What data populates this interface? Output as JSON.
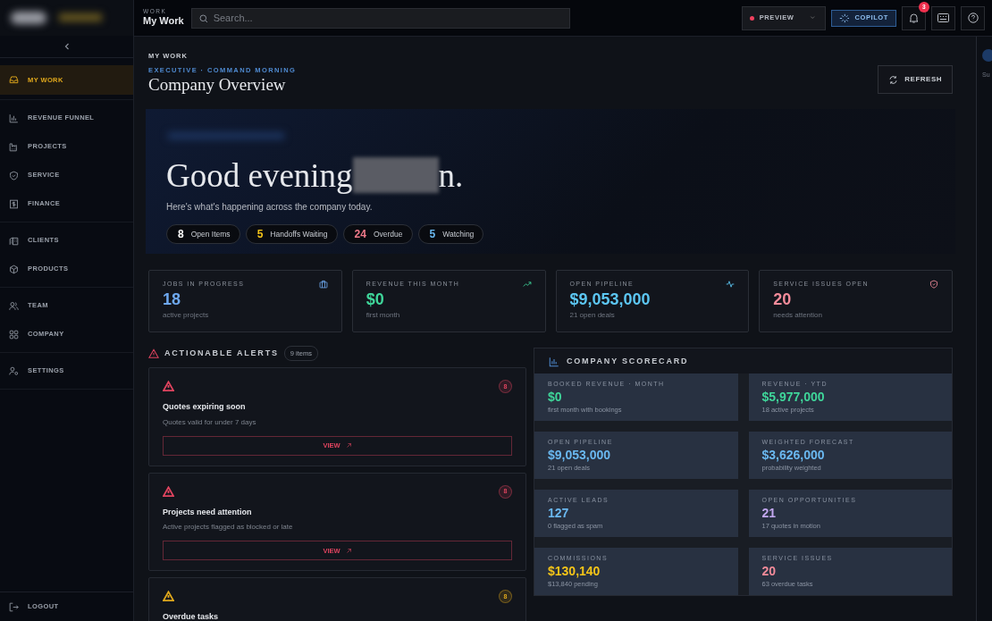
{
  "sidebar": {
    "groups": [
      [
        {
          "label": "MY WORK",
          "selected": true
        }
      ],
      [
        {
          "label": "REVENUE FUNNEL",
          "selected": false
        },
        {
          "label": "PROJECTS",
          "selected": false
        },
        {
          "label": "SERVICE",
          "selected": false
        },
        {
          "label": "FINANCE",
          "selected": false
        }
      ],
      [
        {
          "label": "CLIENTS",
          "selected": false
        },
        {
          "label": "PRODUCTS",
          "selected": false
        }
      ],
      [
        {
          "label": "TEAM",
          "selected": false
        },
        {
          "label": "COMPANY",
          "selected": false
        }
      ],
      [
        {
          "label": "SETTINGS",
          "selected": false
        }
      ]
    ],
    "logout": "LOGOUT"
  },
  "topbar": {
    "eyebrow": "WORK",
    "title": "My Work",
    "search": {
      "placeholder": "Search..."
    },
    "preview": "PREVIEW",
    "copilot": "COPILOT",
    "notifications": "3"
  },
  "side_panel": {
    "tab": "Su"
  },
  "page": {
    "breadcrumb": "MY WORK",
    "eyebrow": "EXECUTIVE · COMMAND MORNING",
    "title": "Company Overview",
    "refresh": "REFRESH"
  },
  "hero": {
    "greeting_start": "Good evening",
    "greeting_end": "n.",
    "subtitle": "Here's what's happening across the company today.",
    "chips": [
      {
        "count": "8",
        "label": "Open Items",
        "color": "#ffffff"
      },
      {
        "count": "5",
        "label": "Handoffs Waiting",
        "color": "#f5c518"
      },
      {
        "count": "24",
        "label": "Overdue",
        "color": "#f27a8a"
      },
      {
        "count": "5",
        "label": "Watching",
        "color": "#6ab8f0"
      }
    ]
  },
  "kpis": [
    {
      "label": "JOBS IN PROGRESS",
      "value": "18",
      "note": "active projects",
      "color": "#6ea8ef"
    },
    {
      "label": "REVENUE THIS MONTH",
      "value": "$0",
      "note": "first month",
      "color": "#3fd69a"
    },
    {
      "label": "OPEN PIPELINE",
      "value": "$9,053,000",
      "note": "21 open deals",
      "color": "#5cc6f2"
    },
    {
      "label": "SERVICE ISSUES OPEN",
      "value": "20",
      "note": "needs attention",
      "color": "#f28b9a"
    }
  ],
  "alerts": {
    "title": "ACTIONABLE ALERTS",
    "count": "9 items",
    "items": [
      {
        "title": "Quotes expiring soon",
        "description": "Quotes valid for under 7 days",
        "count": "8",
        "color": "#e0445f",
        "action": "VIEW"
      },
      {
        "title": "Projects need attention",
        "description": "Active projects flagged as blocked or late",
        "count": "8",
        "color": "#e0445f",
        "action": "VIEW"
      },
      {
        "title": "Overdue tasks",
        "count": "8",
        "color": "#e0a81c"
      }
    ]
  },
  "scorecard": {
    "title": "COMPANY SCORECARD",
    "tiles": [
      {
        "label": "BOOKED REVENUE · MONTH",
        "value": "$0",
        "note": "first month with bookings",
        "color": "#3fd69a"
      },
      {
        "label": "REVENUE · YTD",
        "value": "$5,977,000",
        "note": "18 active projects",
        "color": "#3fd69a"
      },
      {
        "label": "OPEN PIPELINE",
        "value": "$9,053,000",
        "note": "21 open deals",
        "color": "#6ab8f0"
      },
      {
        "label": "WEIGHTED FORECAST",
        "value": "$3,626,000",
        "note": "probability weighted",
        "color": "#6ab8f0"
      },
      {
        "label": "ACTIVE LEADS",
        "value": "127",
        "note": "0 flagged as spam",
        "color": "#6ab8f0"
      },
      {
        "label": "OPEN OPPORTUNITIES",
        "value": "21",
        "note": "17 quotes in motion",
        "color": "#c3a8f0"
      },
      {
        "label": "COMMISSIONS",
        "value": "$130,140",
        "note": "$13,840 pending",
        "color": "#f5c518"
      },
      {
        "label": "SERVICE ISSUES",
        "value": "20",
        "note": "63 overdue tasks",
        "color": "#f28b9a"
      }
    ]
  }
}
